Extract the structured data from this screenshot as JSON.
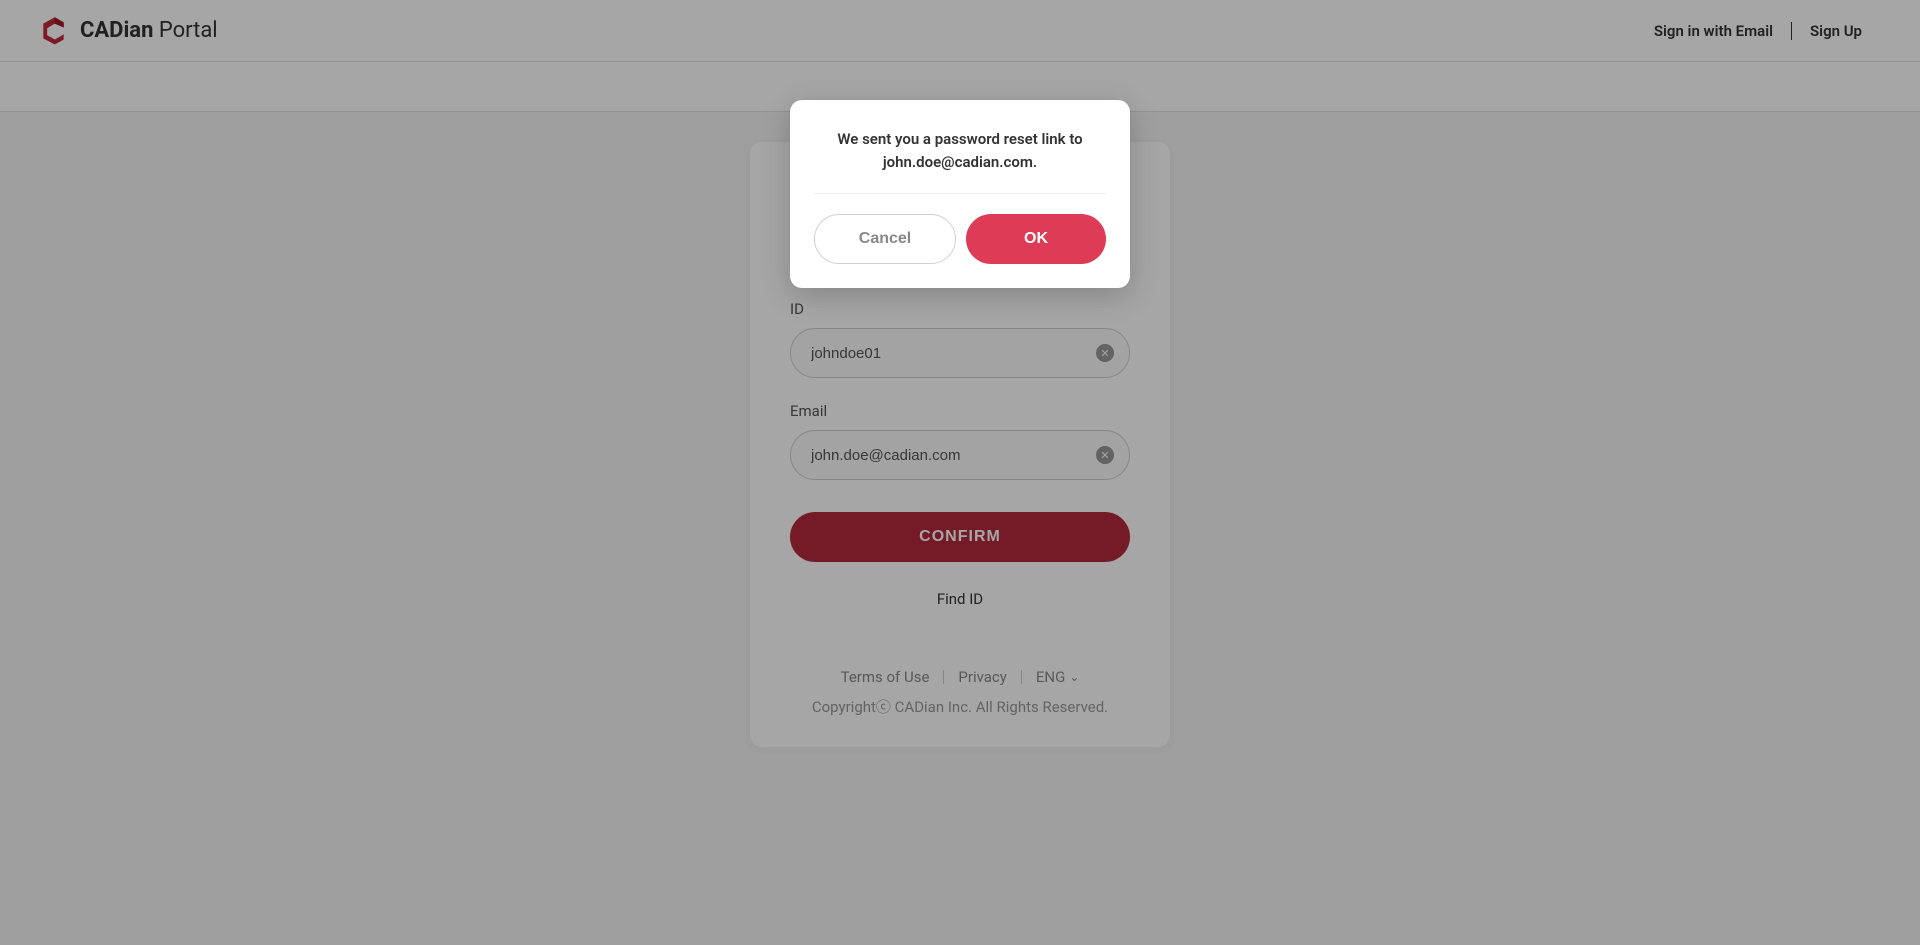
{
  "header": {
    "logo_bold": "CADian",
    "logo_light": " Portal",
    "signin_link": "Sign in with Email",
    "signup_link": "Sign Up"
  },
  "form": {
    "id_label": "ID",
    "id_value": "johndoe01",
    "email_label": "Email",
    "email_value": "john.doe@cadian.com",
    "confirm_button": "CONFIRM",
    "find_id_link": "Find ID"
  },
  "footer": {
    "terms": "Terms of Use",
    "privacy": "Privacy",
    "language": "ENG",
    "copyright": "Copyrightⓒ CADian Inc. All Rights Reserved."
  },
  "modal": {
    "message_prefix": "We sent you a password reset link to ",
    "message_email": "john.doe@cadian.com.",
    "cancel_button": "Cancel",
    "ok_button": "OK"
  }
}
